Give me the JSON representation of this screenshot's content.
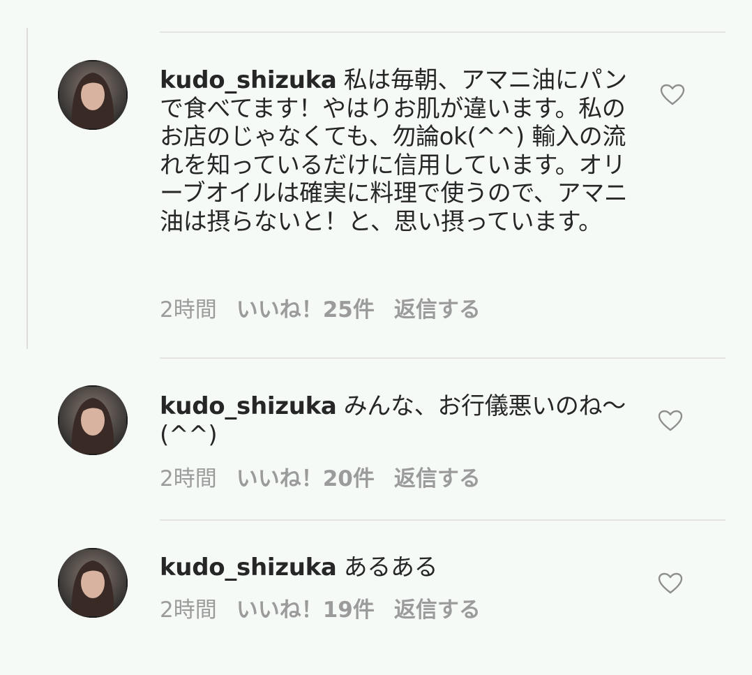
{
  "comments": [
    {
      "username": "kudo_shizuka",
      "text": "私は毎朝、アマニ油にパンで食べてます！やはりお肌が違います。私のお店のじゃなくても、勿論ok(^^) 輸入の流れを知っているだけに信用しています。オリーブオイルは確実に料理で使うので、アマニ油は摂らないと！と、思い摂っています。",
      "time": "2時間",
      "likes": "いいね！25件",
      "reply": "返信する"
    },
    {
      "username": "kudo_shizuka",
      "text": "みんな、お行儀悪いのね〜(^^)",
      "time": "2時間",
      "likes": "いいね！20件",
      "reply": "返信する"
    },
    {
      "username": "kudo_shizuka",
      "text": "あるある",
      "time": "2時間",
      "likes": "いいね！19件",
      "reply": "返信する"
    }
  ],
  "icons": {
    "like": "heart-outline-icon",
    "avatar": "profile-photo"
  },
  "colors": {
    "background": "#f6faf7",
    "text": "#262626",
    "meta": "#9b9b9b",
    "divider": "#e4e4e4"
  }
}
